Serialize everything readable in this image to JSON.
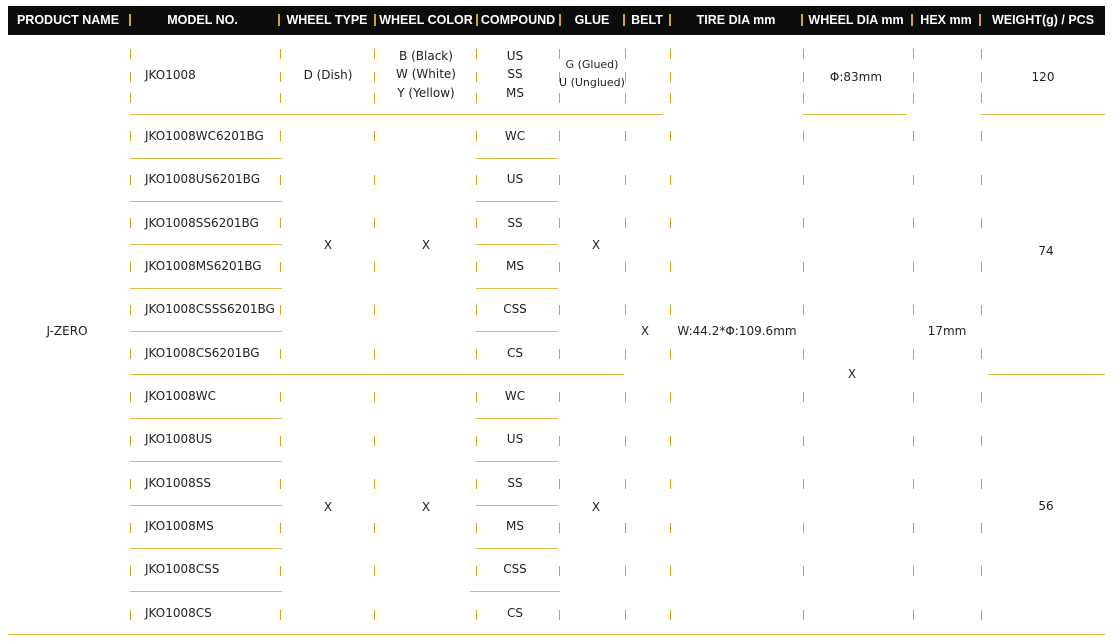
{
  "headers": {
    "product_name": "PRODUCT NAME",
    "model_no": "MODEL NO.",
    "wheel_type": "WHEEL TYPE",
    "wheel_color": "WHEEL COLOR",
    "compound": "COMPOUND",
    "glue": "GLUE",
    "belt": "BELT",
    "tire_dia": "TIRE DIA mm",
    "wheel_dia": "WHEEL DIA mm",
    "hex": "HEX mm",
    "weight": "WEIGHT(g) / PCS"
  },
  "product_name": "J-ZERO",
  "top_row": {
    "model": "JKO1008",
    "wheel_type": "D (Dish)",
    "wheel_colors": [
      "B (Black)",
      "W (White)",
      "Y (Yellow)"
    ],
    "compounds": [
      "US",
      "SS",
      "MS"
    ],
    "glue": [
      "G (Glued)",
      "U (Unglued)"
    ],
    "wheel_dia": "Φ:83mm",
    "weight": "120"
  },
  "group1": {
    "models": [
      "JKO1008WC6201BG",
      "JKO1008US6201BG",
      "JKO1008SS6201BG",
      "JKO1008MS6201BG",
      "JKO1008CSSS6201BG",
      "JKO1008CS6201BG"
    ],
    "compounds": [
      "WC",
      "US",
      "SS",
      "MS",
      "CSS",
      "CS"
    ],
    "wheel_type": "X",
    "wheel_color": "X",
    "glue": "X",
    "weight": "74"
  },
  "group2": {
    "models": [
      "JKO1008WC",
      "JKO1008US",
      "JKO1008SS",
      "JKO1008MS",
      "JKO1008CSS",
      "JKO1008CS"
    ],
    "compounds": [
      "WC",
      "US",
      "SS",
      "MS",
      "CSS",
      "CS"
    ],
    "wheel_type": "X",
    "wheel_color": "X",
    "glue": "X",
    "weight": "56"
  },
  "belt": "X",
  "tire_dia": "W:44.2*Φ:109.6mm",
  "wheel_dia_x": "X",
  "hex": "17mm",
  "colors": {
    "header_bg": "#0b0b0b",
    "header_text": "#ffffff",
    "accent": "#d6a31a",
    "rule": "#e0bb4a"
  }
}
